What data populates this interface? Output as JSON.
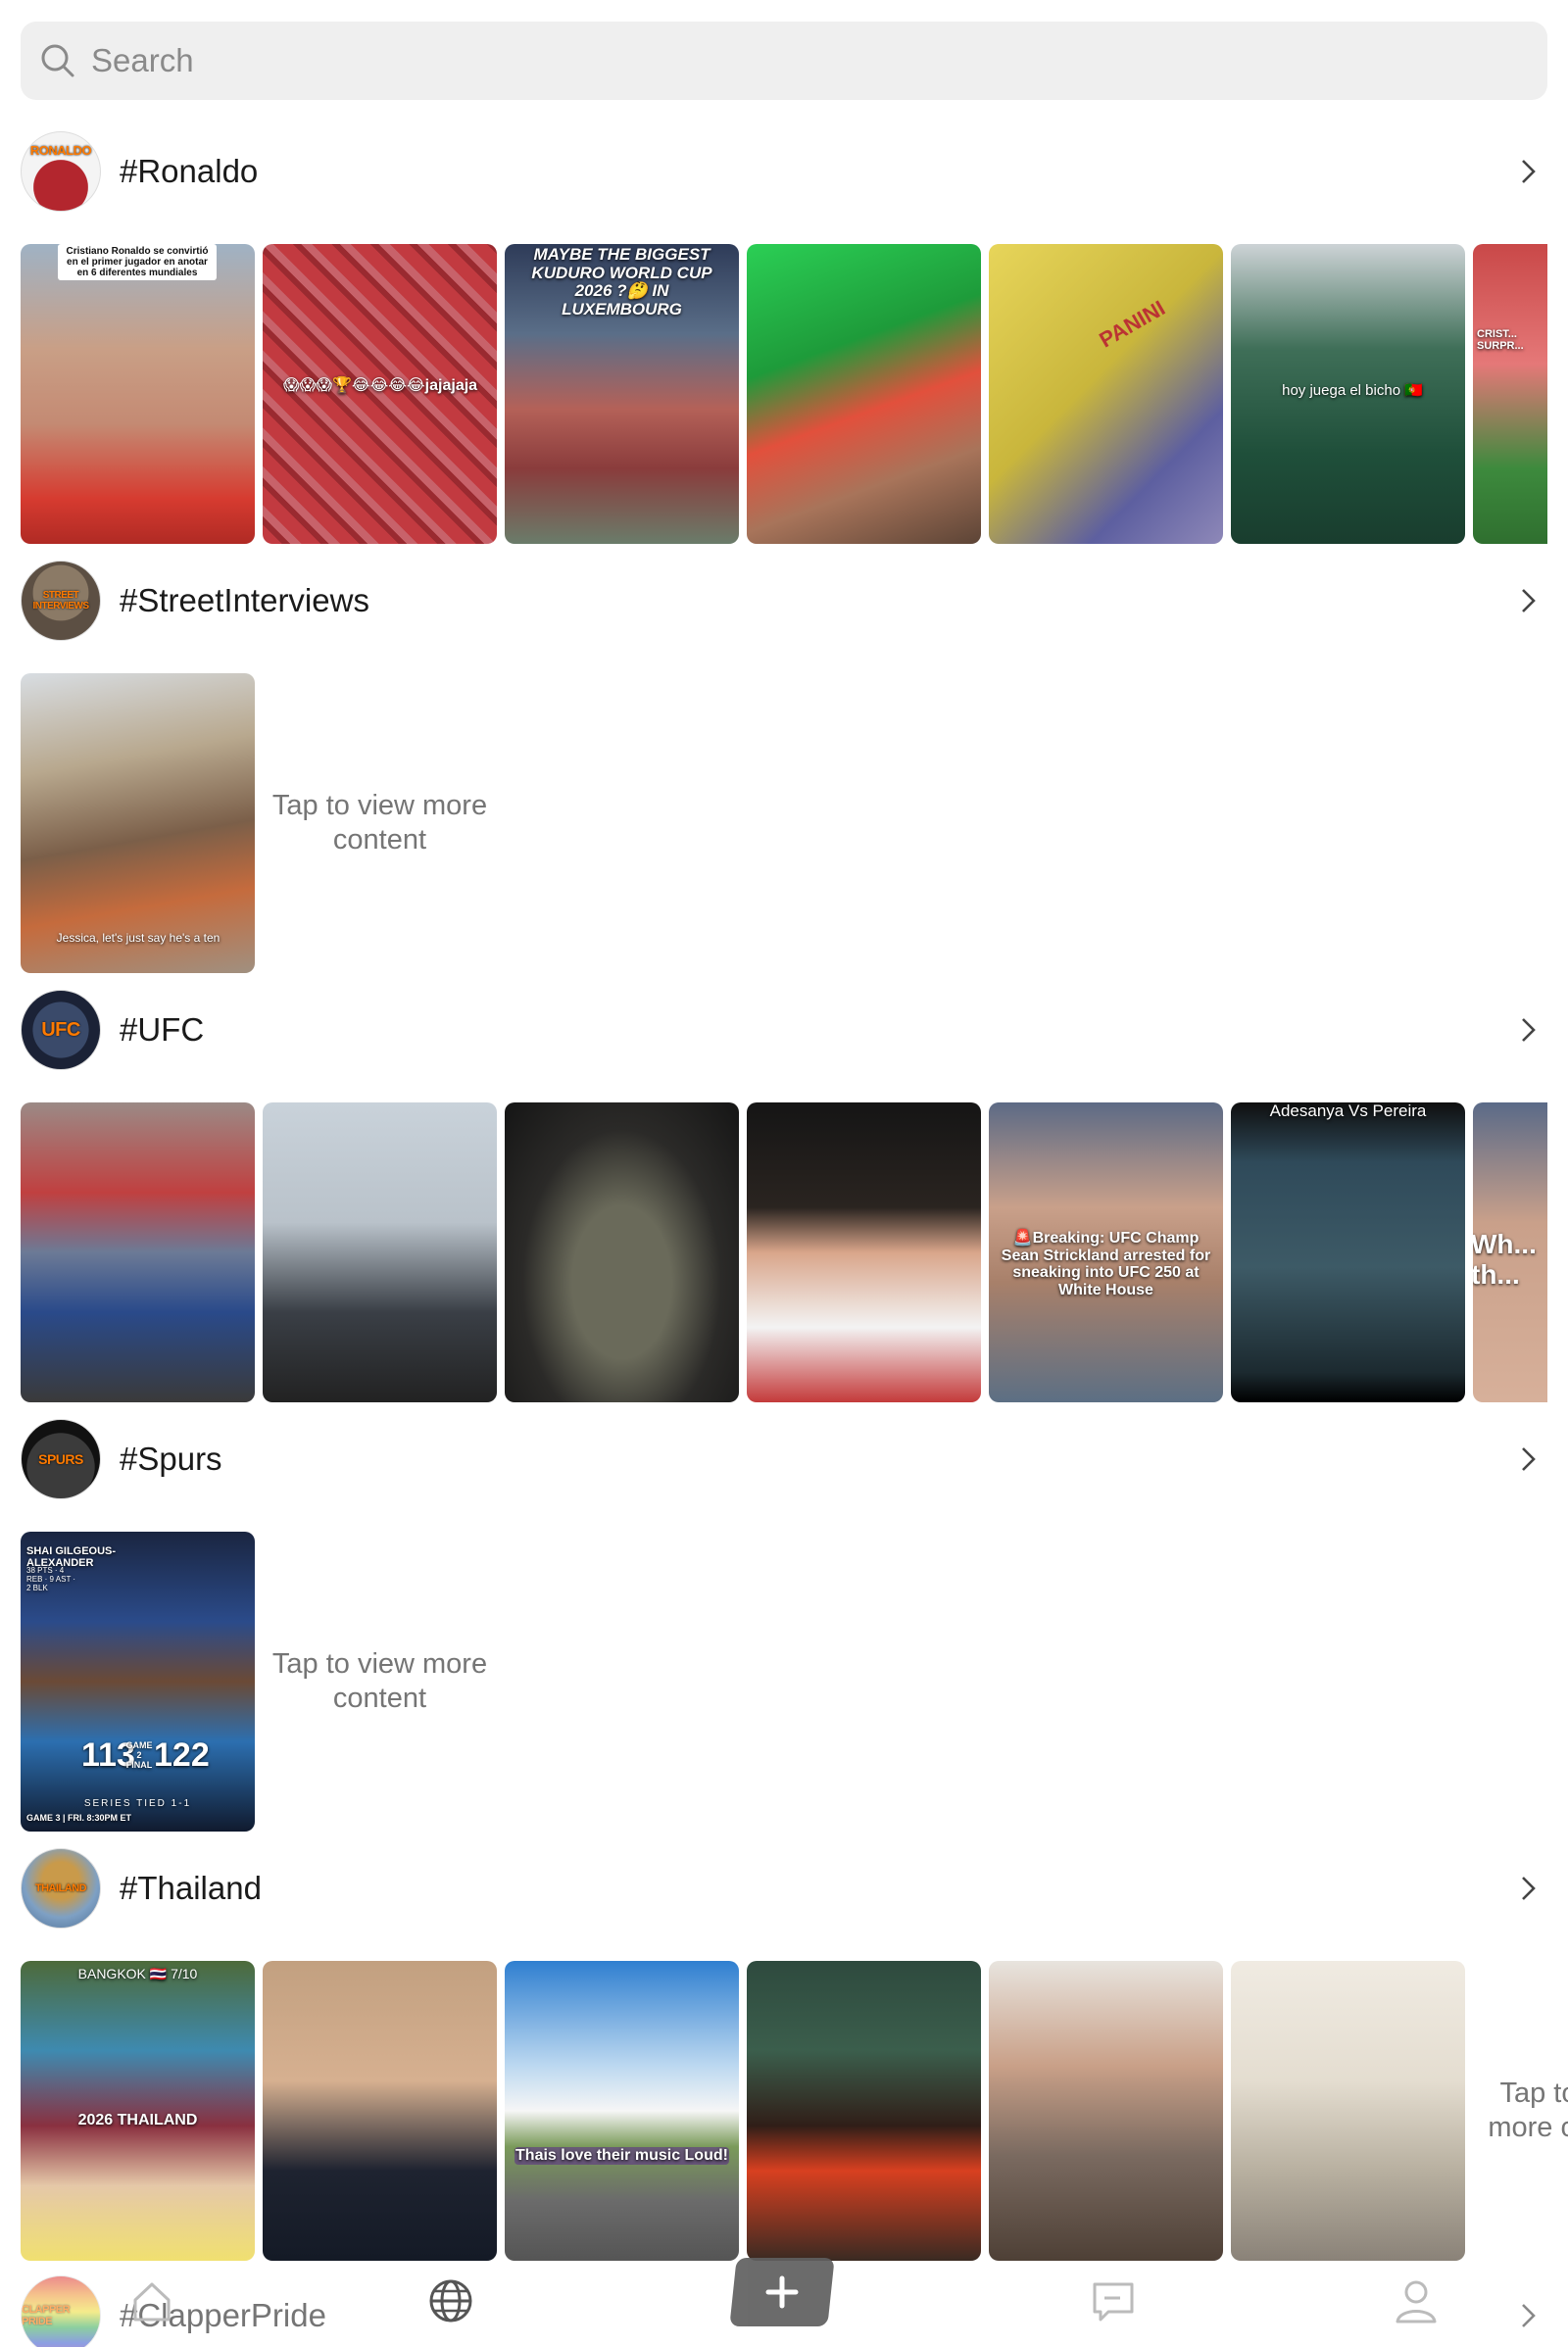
{
  "search": {
    "placeholder": "Search"
  },
  "sections": [
    {
      "tag": "#Ronaldo",
      "avatar_text": "RONALDO",
      "captions": {
        "t0": "Cristiano Ronaldo se convirtió en el primer jugador en anotar en 6 diferentes mundiales",
        "t1": "😱😱😱🏆😂😂😂😂jajajaja",
        "t2": "MAYBE THE BIGGEST KUDURO WORLD CUP 2026 ?🤔 IN LUXEMBOURG",
        "t4": "PANINI",
        "t5": "hoy juega el bicho 🇵🇹",
        "t6": "CRIST... SURPR..."
      }
    },
    {
      "tag": "#StreetInterviews",
      "avatar_text": "STREET INTERVIEWS",
      "captions": {
        "t0": "Jessica, let's just say he's a ten"
      },
      "tap_text": "Tap to view more content"
    },
    {
      "tag": "#UFC",
      "avatar_text": "UFC",
      "captions": {
        "t4": "🚨Breaking: UFC Champ Sean Strickland arrested for sneaking into UFC 250 at White House",
        "t5": "Adesanya Vs Pereira",
        "t6": "Wh... th..."
      }
    },
    {
      "tag": "#Spurs",
      "avatar_text": "SPURS",
      "captions": {
        "t0_name": "SHAI GILGEOUS-ALEXANDER",
        "t0_stats": "38 PTS · 4 REB · 9 AST · 2 BLK",
        "t0_score_left": "113",
        "t0_game": "GAME 2 FINAL",
        "t0_score_right": "122",
        "t0_series": "SERIES TIED 1-1",
        "t0_next": "GAME 3 | FRI. 8:30PM ET"
      },
      "tap_text": "Tap to view more content"
    },
    {
      "tag": "#Thailand",
      "avatar_text": "THAILAND",
      "captions": {
        "t0_top": "BANGKOK 🇹🇭 7/10",
        "t0_main": "2026 THAILAND",
        "t2": "Thais love their music Loud!"
      },
      "tap_text": "Tap to view more content"
    },
    {
      "tag": "#ClapperPride",
      "avatar_text": "CLAPPER PRIDE"
    }
  ],
  "nav": {
    "items": [
      "home-icon",
      "globe-icon",
      "plus-icon",
      "message-icon",
      "profile-icon"
    ],
    "plus_color": "#5f5f5f"
  }
}
